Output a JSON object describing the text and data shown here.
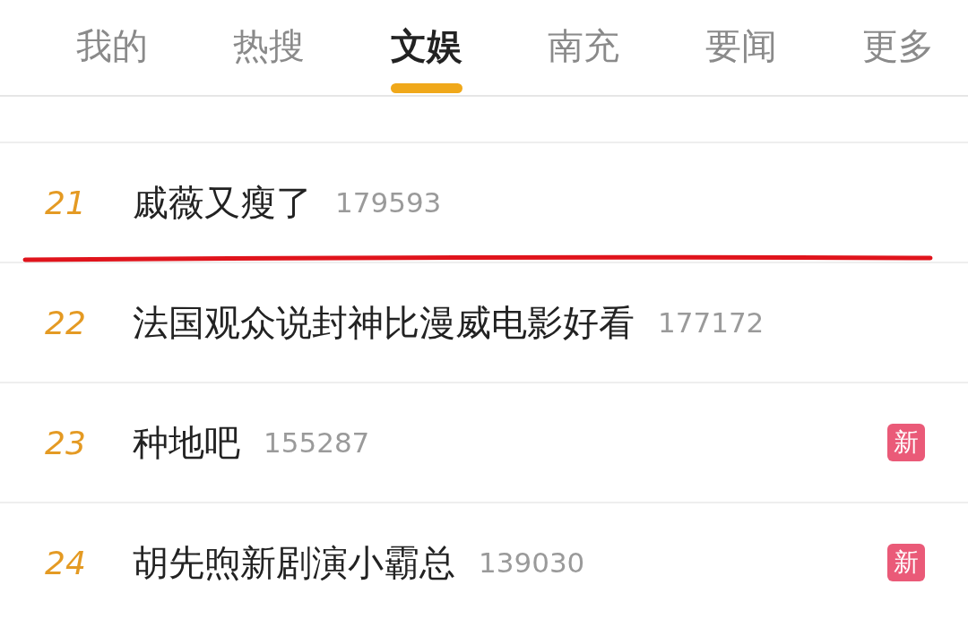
{
  "tabs": [
    {
      "label": "我的",
      "selected": false
    },
    {
      "label": "热搜",
      "selected": false
    },
    {
      "label": "文娱",
      "selected": true
    },
    {
      "label": "南充",
      "selected": false
    },
    {
      "label": "要闻",
      "selected": false
    },
    {
      "label": "更多",
      "selected": false
    }
  ],
  "rows": [
    {
      "rank": "21",
      "title": "戚薇又瘦了",
      "count": "179593"
    },
    {
      "rank": "22",
      "title": "法国观众说封神比漫威电影好看",
      "count": "177172"
    },
    {
      "rank": "23",
      "title": "种地吧",
      "count": "155287",
      "badge": "新"
    },
    {
      "rank": "24",
      "title": "胡先煦新剧演小霸总",
      "count": "139030",
      "badge": "新"
    }
  ]
}
